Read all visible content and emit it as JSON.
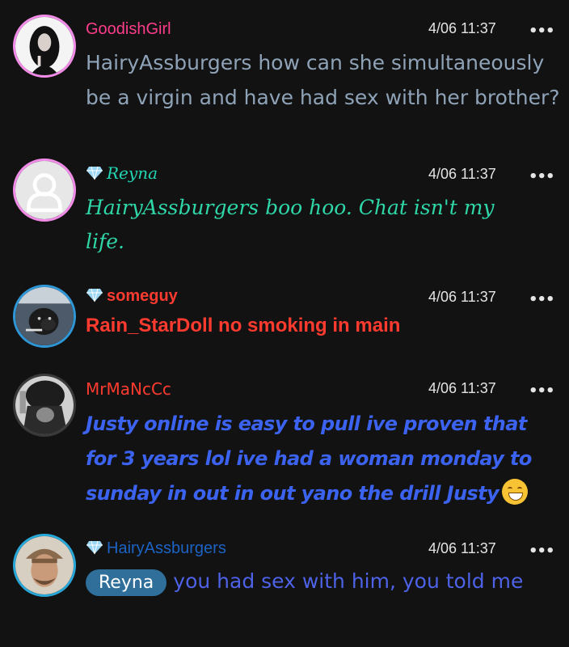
{
  "messages": [
    {
      "username": "GoodishGirl",
      "timestamp": "4/06 11:37",
      "text": "HairyAssburgers how can she simultaneously be a virgin and have had sex with her brother?",
      "name_color": "#ff3d8b",
      "text_color": "#8fa3b8",
      "avatar_border": "#f28ce8",
      "has_gem": false
    },
    {
      "username": "Reyna",
      "timestamp": "4/06 11:37",
      "text": "HairyAssburgers boo hoo. Chat isn't my life.",
      "name_color": "#23d6b4",
      "text_color": "#2fd7a8",
      "avatar_border": "#f28ce8",
      "has_gem": true
    },
    {
      "username": "someguy",
      "timestamp": "4/06 11:37",
      "text": "Rain_StarDoll no smoking in main",
      "name_color": "#ff3b30",
      "text_color": "#ff3b30",
      "avatar_border": "#2f97d6",
      "has_gem": true
    },
    {
      "username": "MrMaNcCc",
      "timestamp": "4/06 11:37",
      "text": "Justy online is easy to pull ive proven that for 3 years lol ive had a woman monday to sunday in out in out yano the drill Justy",
      "name_color": "#ff3b30",
      "text_color": "#3b63f0",
      "avatar_border": "#3a3a3a",
      "has_gem": false
    },
    {
      "username": "HairyAssburgers",
      "timestamp": "4/06 11:37",
      "mention": "Reyna",
      "text": "you had sex with him, you told me",
      "name_color": "#1c63c4",
      "text_color": "#4d62e6",
      "avatar_border": "#28a7d9",
      "has_gem": true
    }
  ],
  "icons": {
    "more": "more-options-icon",
    "gem": "diamond-icon",
    "emoji": "grinning-face-emoji"
  },
  "more_glyph": "•••"
}
